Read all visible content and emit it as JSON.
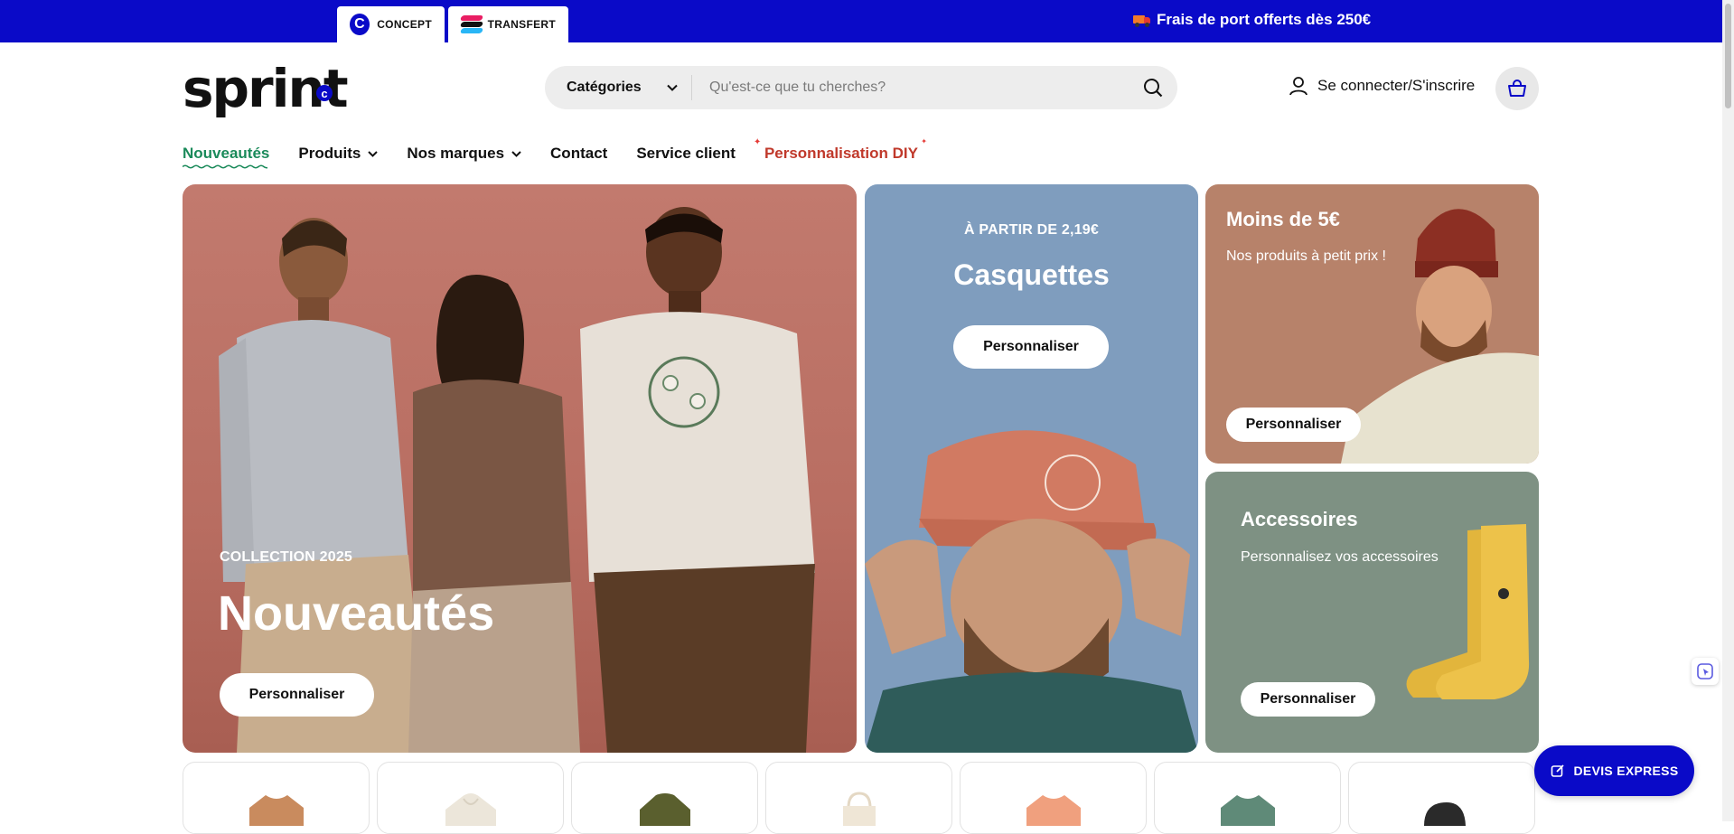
{
  "topbar": {
    "tabs": [
      {
        "label": "CONCEPT",
        "icon": "concept-logo-icon"
      },
      {
        "label": "TRANSFERT",
        "icon": "transfert-logo-icon"
      }
    ],
    "promo_text": "Frais de port offerts dès 250€",
    "promo_icon": "truck-icon",
    "bg_color": "#0a0ac8"
  },
  "header": {
    "logo_text": "sprint",
    "logo_badge": "c",
    "search": {
      "category_label": "Catégories",
      "placeholder": "Qu'est-ce que tu cherches?"
    },
    "login_label": "Se connecter/S'inscrire"
  },
  "nav": {
    "items": [
      {
        "label": "Nouveautés",
        "active": true
      },
      {
        "label": "Produits",
        "dropdown": true
      },
      {
        "label": "Nos marques",
        "dropdown": true
      },
      {
        "label": "Contact"
      },
      {
        "label": "Service client"
      },
      {
        "label": "Personnalisation DIY",
        "highlight": true
      }
    ]
  },
  "hero": {
    "left": {
      "kicker": "COLLECTION 2025",
      "title": "Nouveautés",
      "button": "Personnaliser"
    },
    "middle": {
      "kicker": "À PARTIR DE 2,19€",
      "title": "Casquettes",
      "button": "Personnaliser"
    },
    "right_top": {
      "title": "Moins de 5€",
      "subtitle": "Nos produits à petit prix !",
      "button": "Personnaliser"
    },
    "right_bottom": {
      "title": "Accessoires",
      "subtitle": "Personnalisez vos accessoires",
      "button": "Personnaliser"
    }
  },
  "floating": {
    "devis_label": "DEVIS EXPRESS"
  },
  "products": [
    {
      "color": "#c98b5e",
      "icon": "tshirt-icon"
    },
    {
      "color": "#ece6da",
      "icon": "hoodie-icon"
    },
    {
      "color": "#5a5f2e",
      "icon": "jacket-icon"
    },
    {
      "color": "#efe6d6",
      "icon": "tote-bag-icon"
    },
    {
      "color": "#f0a07e",
      "icon": "tshirt-icon"
    },
    {
      "color": "#5f8a78",
      "icon": "tshirt-icon"
    },
    {
      "color": "#2a2a2a",
      "icon": "cap-icon"
    }
  ]
}
